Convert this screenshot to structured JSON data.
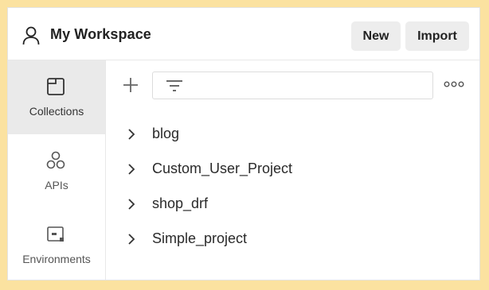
{
  "header": {
    "workspace_icon": "person-icon",
    "title": "My Workspace",
    "new_label": "New",
    "import_label": "Import"
  },
  "sidebar": {
    "items": [
      {
        "label": "Collections",
        "icon": "collection-icon",
        "active": true
      },
      {
        "label": "APIs",
        "icon": "apis-icon",
        "active": false
      },
      {
        "label": "Environments",
        "icon": "environment-icon",
        "active": false
      }
    ]
  },
  "toolbar": {
    "add_icon": "plus-icon",
    "filter_icon": "filter-icon",
    "filter_value": "",
    "more_icon": "more-horizontal-icon"
  },
  "collections": [
    {
      "name": "blog"
    },
    {
      "name": "Custom_User_Project"
    },
    {
      "name": "shop_drf"
    },
    {
      "name": "Simple_project"
    }
  ],
  "colors": {
    "outer_border": "#fbe2a0",
    "active_sidebar_bg": "#eaeaea",
    "button_bg": "#ededed"
  }
}
